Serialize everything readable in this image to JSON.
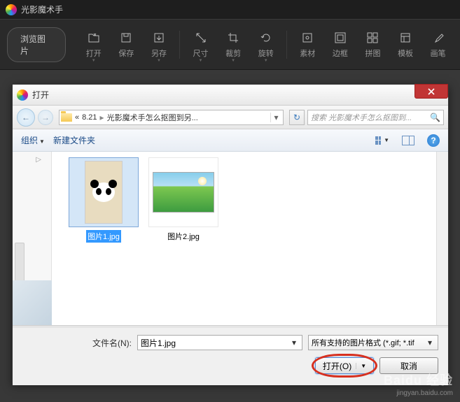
{
  "app": {
    "title": "光影魔术手",
    "browse_btn": "浏览图片",
    "tools": [
      {
        "label": "打开",
        "icon": "folder-out",
        "dd": true
      },
      {
        "label": "保存",
        "icon": "save"
      },
      {
        "label": "另存",
        "icon": "save-as",
        "dd": true
      },
      {
        "label": "尺寸",
        "icon": "resize",
        "dd": true
      },
      {
        "label": "裁剪",
        "icon": "crop",
        "dd": true
      },
      {
        "label": "旋转",
        "icon": "rotate",
        "dd": true
      },
      {
        "label": "素材",
        "icon": "material"
      },
      {
        "label": "边框",
        "icon": "border"
      },
      {
        "label": "拼图",
        "icon": "collage"
      },
      {
        "label": "模板",
        "icon": "template"
      },
      {
        "label": "画笔",
        "icon": "brush"
      }
    ]
  },
  "dialog": {
    "title": "打开",
    "breadcrumb": {
      "p1": "8.21",
      "p2": "光影魔术手怎么抠图到另..."
    },
    "search_placeholder": "搜索 光影魔术手怎么抠图到...",
    "toolbar": {
      "organize": "组织",
      "newfolder": "新建文件夹"
    },
    "files": [
      {
        "name": "图片1.jpg",
        "selected": true,
        "kind": "panda"
      },
      {
        "name": "图片2.jpg",
        "selected": false,
        "kind": "landscape"
      }
    ],
    "filename_label": "文件名(N):",
    "filename_value": "图片1.jpg",
    "filter_label": "所有支持的图片格式 (*.gif; *.tif",
    "open_btn": "打开(O)",
    "cancel_btn": "取消"
  },
  "watermark": {
    "logo": "Baidu 经验",
    "url": "jingyan.baidu.com"
  }
}
